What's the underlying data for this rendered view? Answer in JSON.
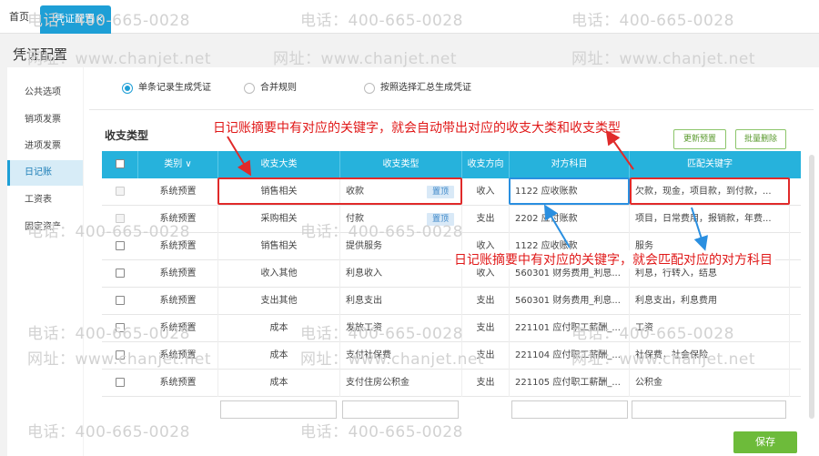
{
  "tabs": {
    "home": "首页",
    "active": "凭证配置",
    "close": "×"
  },
  "page_title": "凭证配置",
  "sidebar": {
    "items": [
      {
        "label": "公共选项"
      },
      {
        "label": "销项发票"
      },
      {
        "label": "进项发票"
      },
      {
        "label": "日记账",
        "active": true
      },
      {
        "label": "工资表"
      },
      {
        "label": "固定资产"
      }
    ]
  },
  "radios": [
    {
      "label": "单条记录生成凭证",
      "checked": true
    },
    {
      "label": "合并规则",
      "checked": false
    },
    {
      "label": "按照选择汇总生成凭证",
      "checked": false
    }
  ],
  "section_title": "收支类型",
  "buttons": {
    "update_preset": "更新预置",
    "batch_delete": "批量删除",
    "save": "保存"
  },
  "table": {
    "headers": [
      "类别",
      "收支大类",
      "收支类型",
      "收支方向",
      "对方科目",
      "匹配关键字"
    ],
    "header_arrow": "∨",
    "rows": [
      {
        "cat": "系统预置",
        "major": "销售相关",
        "type": "收款",
        "top": "置顶",
        "dir": "收入",
        "acct": "1122 应收账款",
        "kw": "欠款，现金，项目款，到付款，...",
        "disabled": true
      },
      {
        "cat": "系统预置",
        "major": "采购相关",
        "type": "付款",
        "top": "置顶",
        "dir": "支出",
        "acct": "2202 应付账款",
        "kw": "项目，日常费用，报销款，年费...",
        "disabled": true
      },
      {
        "cat": "系统预置",
        "major": "销售相关",
        "type": "提供服务",
        "top": "",
        "dir": "收入",
        "acct": "1122 应收账款",
        "kw": "服务",
        "disabled": false
      },
      {
        "cat": "系统预置",
        "major": "收入其他",
        "type": "利息收入",
        "top": "",
        "dir": "收入",
        "acct": "560301 财务费用_利息...",
        "kw": "利息，行转入，结息",
        "disabled": false
      },
      {
        "cat": "系统预置",
        "major": "支出其他",
        "type": "利息支出",
        "top": "",
        "dir": "支出",
        "acct": "560301 财务费用_利息...",
        "kw": "利息支出，利息费用",
        "disabled": false
      },
      {
        "cat": "系统预置",
        "major": "成本",
        "type": "发放工资",
        "top": "",
        "dir": "支出",
        "acct": "221101 应付职工薪酬_...",
        "kw": "工资",
        "disabled": false
      },
      {
        "cat": "系统预置",
        "major": "成本",
        "type": "支付社保费",
        "top": "",
        "dir": "支出",
        "acct": "221104 应付职工薪酬_...",
        "kw": "社保费，社会保险",
        "disabled": false
      },
      {
        "cat": "系统预置",
        "major": "成本",
        "type": "支付住房公积金",
        "top": "",
        "dir": "支出",
        "acct": "221105 应付职工薪酬_...",
        "kw": "公积金",
        "disabled": false
      }
    ]
  },
  "annotations": {
    "top": "日记账摘要中有对应的关键字，就会自动带出对应的收支大类和收支类型",
    "bottom": "日记账摘要中有对应的关键字，就会匹配对应的对方科目"
  },
  "watermark": {
    "phone": "电话：400-665-0028",
    "site": "网址：www.chanjet.net"
  },
  "colors": {
    "accent": "#1e9fd6",
    "header": "#26b2dc",
    "annotation": "#e01818",
    "save": "#6dbb3a"
  }
}
